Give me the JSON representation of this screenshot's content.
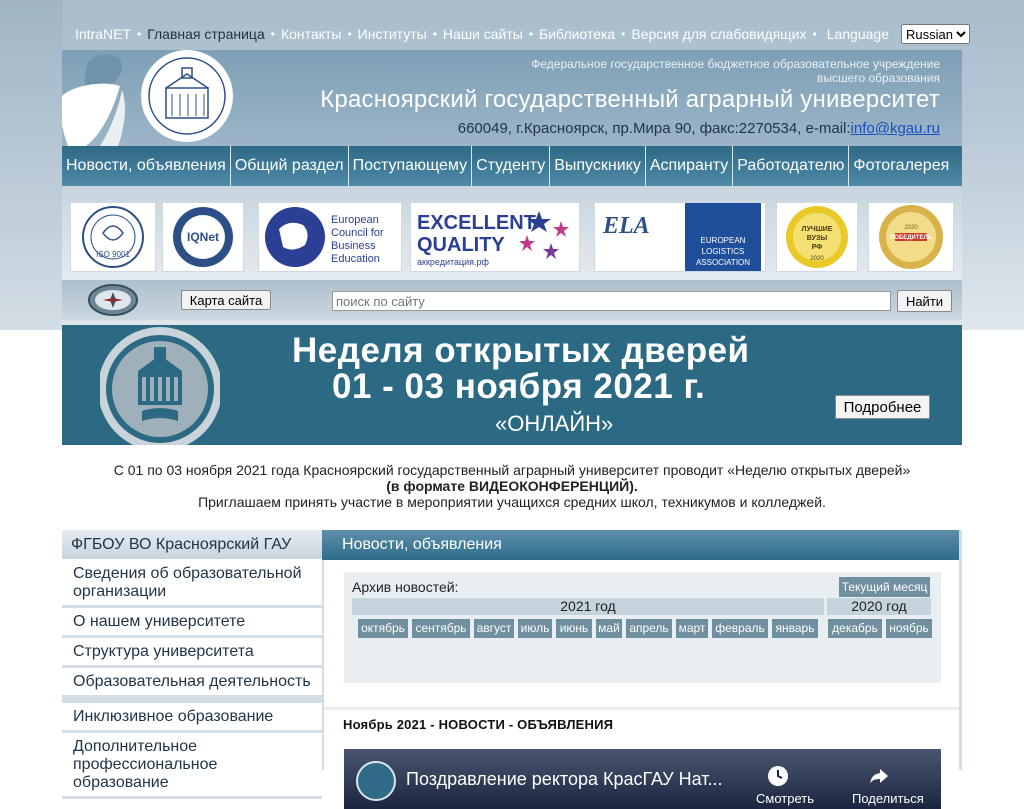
{
  "toplinks": {
    "intranet": "IntraNET",
    "home": "Главная страница",
    "contacts": "Контакты",
    "institutes": "Институты",
    "our_sites": "Наши сайты",
    "library": "Библиотека",
    "low_vision": "Версия для слабовидящих",
    "language_label": "Language",
    "language_selected": "Russian"
  },
  "header": {
    "subtitle_1": "Федеральное государственное бюджетное образовательное учреждение",
    "subtitle_2": "высшего образования",
    "title": "Красноярский государственный аграрный университет",
    "address": "660049, г.Красноярск, пр.Мира 90, факс:2270534, e-mail:",
    "email": "info@kgau.ru"
  },
  "nav": [
    "Новости, объявления",
    "Общий раздел",
    "Поступающему",
    "Студенту",
    "Выпускнику",
    "Аспиранту",
    "Работодателю",
    "Фотогалерея"
  ],
  "logos": {
    "iso": "ISO 9001",
    "iqnet": "IQNet",
    "ecbe": "European Council for Business Education",
    "eq_1": "EXCELLENT",
    "eq_2": "QUALITY",
    "eq_3": "аккредитация.рф",
    "ela": "ELA",
    "ela_1": "EUROPEAN",
    "ela_2": "LOGISTICS",
    "ela_3": "ASSOCIATION",
    "best_1": "ЛУЧШИЕ",
    "best_2": "ВУЗЫ",
    "best_3": "РФ",
    "best_4": "2020",
    "winner_1": "ПОБЕДИТЕЛЬ",
    "winner_2": "2020"
  },
  "search": {
    "sitemap_label": "Карта сайта",
    "placeholder": "поиск по сайту",
    "button_label": "Найти"
  },
  "banner": {
    "line1": "Неделя открытых дверей",
    "line2": "01 - 03 ноября 2021 г.",
    "line3": "«ОНЛАЙН»",
    "more_label": "Подробнее"
  },
  "intro": {
    "line1": "С 01 по 03 ноября 2021 года Красноярский государственный аграрный университет проводит «Неделю открытых дверей»",
    "line2": "(в формате ВИДЕОКОНФЕРЕНЦИЙ).",
    "line3": "Приглашаем принять участие в мероприятии учащихся средних школ, техникумов и колледжей."
  },
  "sidebar": {
    "header": "ФГБОУ ВО Красноярский ГАУ",
    "items": [
      "Сведения об образовательной организации",
      "О нашем университете",
      "Структура университета",
      "Образовательная деятельность",
      "Инклюзивное образование",
      "Дополнительное профессиональное образование"
    ]
  },
  "news": {
    "header": "Новости, объявления",
    "archive_label": "Архив новостей:",
    "current_month": "Текущий месяц",
    "year_2021": "2021 год",
    "year_2020": "2020 год",
    "months_2021": [
      "октябрь",
      "сентябрь",
      "август",
      "июль",
      "июнь",
      "май",
      "апрель",
      "март",
      "февраль",
      "январь"
    ],
    "months_2020": [
      "декабрь",
      "ноябрь"
    ],
    "section_title": "Ноябрь 2021 - НОВОСТИ - ОБЪЯВЛЕНИЯ",
    "video_title": "Поздравление ректора КрасГАУ Нат...",
    "video_watch_later": "Смотреть",
    "video_share": "Поделиться"
  },
  "colors": {
    "nav_bg": "#2e6a86",
    "banner_bg": "#2c6a84",
    "month_button": "#708f9f",
    "link": "#1a4fc0"
  }
}
